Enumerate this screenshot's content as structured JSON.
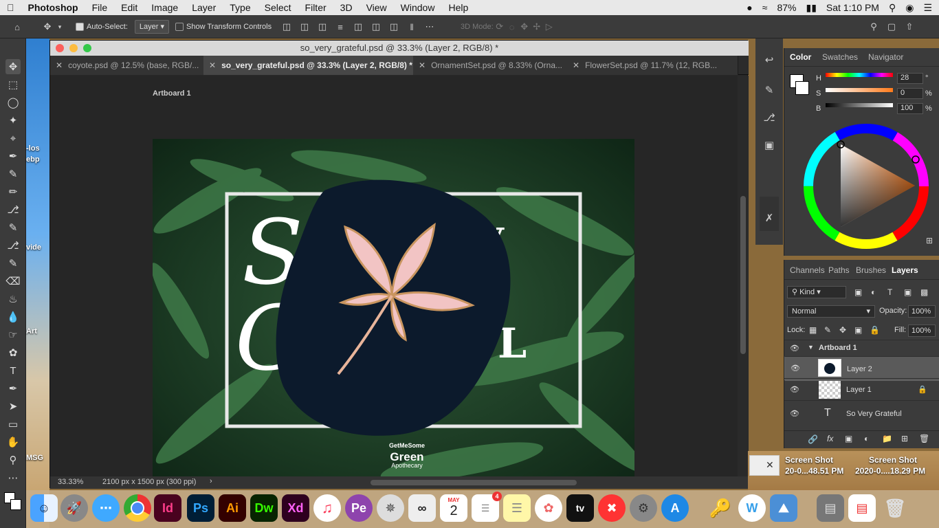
{
  "menubar": {
    "app": "Photoshop",
    "items": [
      "File",
      "Edit",
      "Image",
      "Layer",
      "Type",
      "Select",
      "Filter",
      "3D",
      "View",
      "Window",
      "Help"
    ],
    "battery": "87%",
    "clock": "Sat 1:10 PM"
  },
  "options": {
    "auto_select_label": "Auto-Select:",
    "auto_select_value": "Layer",
    "transform_label": "Show Transform Controls",
    "mode3d_label": "3D Mode:"
  },
  "document": {
    "title": "so_very_grateful.psd @ 33.3% (Layer 2, RGB/8) *",
    "tabs": [
      {
        "label": "coyote.psd @ 12.5% (base, RGB/..."
      },
      {
        "label": "so_very_grateful.psd @ 33.3% (Layer 2, RGB/8) *"
      },
      {
        "label": "OrnamentSet.psd @ 8.33% (Orna..."
      },
      {
        "label": "FlowerSet.psd @ 11.7% (12, RGB..."
      }
    ],
    "artboard_label": "Artboard 1",
    "zoom": "33.33%",
    "doc_info": "2100 px x 1500 px (300 ppi)",
    "art_text": {
      "line1a": "So",
      "line1b": "y",
      "line2a": "G",
      "line2b": "L"
    },
    "logo": {
      "top": "GetMeSome",
      "mid": "Green",
      "bottom": "Apothecary"
    }
  },
  "color_panel": {
    "tabs": [
      "Color",
      "Swatches",
      "Navigator"
    ],
    "h_label": "H",
    "h_value": "28",
    "h_unit": "°",
    "s_label": "S",
    "s_value": "0",
    "s_unit": "%",
    "b_label": "B",
    "b_value": "100",
    "b_unit": "%"
  },
  "layers_panel": {
    "tabs": [
      "Channels",
      "Paths",
      "Brushes",
      "Layers"
    ],
    "kind_label": "Kind",
    "blend_mode": "Normal",
    "opacity_label": "Opacity:",
    "opacity_value": "100%",
    "lock_label": "Lock:",
    "fill_label": "Fill:",
    "fill_value": "100%",
    "group": "Artboard 1",
    "layers": [
      {
        "name": "Layer 2"
      },
      {
        "name": "Layer 1"
      },
      {
        "name": "So Very Grateful"
      }
    ]
  },
  "desktop": {
    "screenshot1": {
      "title": "Screen Shot",
      "sub": "20-0...48.51 PM"
    },
    "screenshot2": {
      "title": "Screen Shot",
      "sub": "2020-0....18.29 PM"
    },
    "left_frag1": "-los",
    "left_frag2": "ebp",
    "left_frag3": "vide",
    "left_frag4": "Art",
    "left_frag5": "MSG"
  },
  "dock": {
    "apps": [
      "Finder",
      "Launchpad",
      "Messages",
      "Chrome",
      "InDesign",
      "Photoshop",
      "Illustrator",
      "Dreamweaver",
      "XD",
      "Music",
      "Premiere Elements",
      "Cord",
      "Lasso",
      "Calendar",
      "Reminders",
      "Notes",
      "Photos",
      "TV",
      "News",
      "System Preferences",
      "App Store",
      "Keychain",
      "Word",
      "Preview",
      "Archive",
      "Sheet",
      "Trash"
    ],
    "calendar_month": "MAY",
    "calendar_day": "2",
    "reminders_badge": "4",
    "labels": {
      "id": "Id",
      "ps": "Ps",
      "ai": "Ai",
      "dw": "Dw",
      "xd": "Xd",
      "pe": "Pe",
      "tv": "tv"
    }
  }
}
